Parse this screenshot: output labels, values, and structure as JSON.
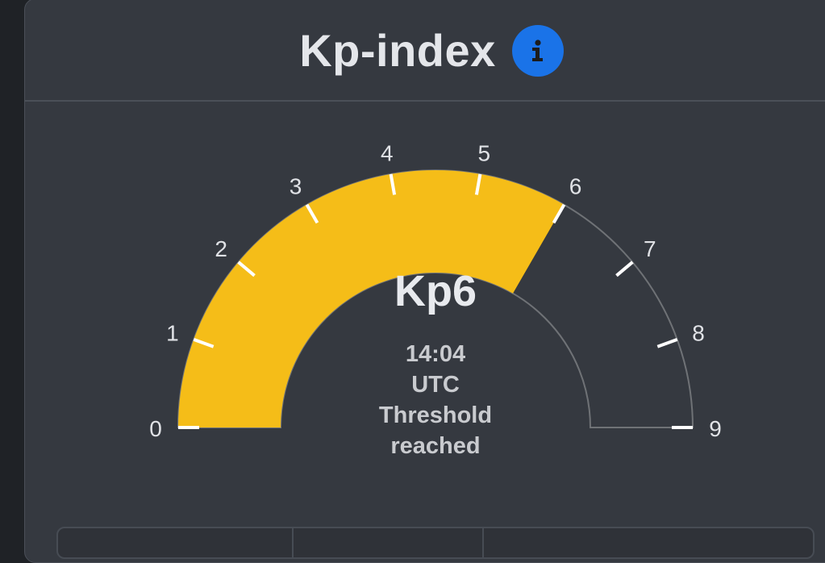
{
  "header": {
    "title": "Kp-index",
    "info_icon": "info-icon"
  },
  "gauge": {
    "value": 6,
    "min": 0,
    "max": 9,
    "value_label": "Kp6",
    "time": "14:04",
    "timezone": "UTC",
    "status_line1": "Threshold",
    "status_line2": "reached",
    "tick_labels": [
      "0",
      "1",
      "2",
      "3",
      "4",
      "5",
      "6",
      "7",
      "8",
      "9"
    ],
    "fill_color": "#f5bd18",
    "track_color": "#6f7276",
    "tick_color": "#ffffff"
  },
  "colors": {
    "background": "#1f2226",
    "card": "#353940",
    "accent": "#1a73e8"
  }
}
